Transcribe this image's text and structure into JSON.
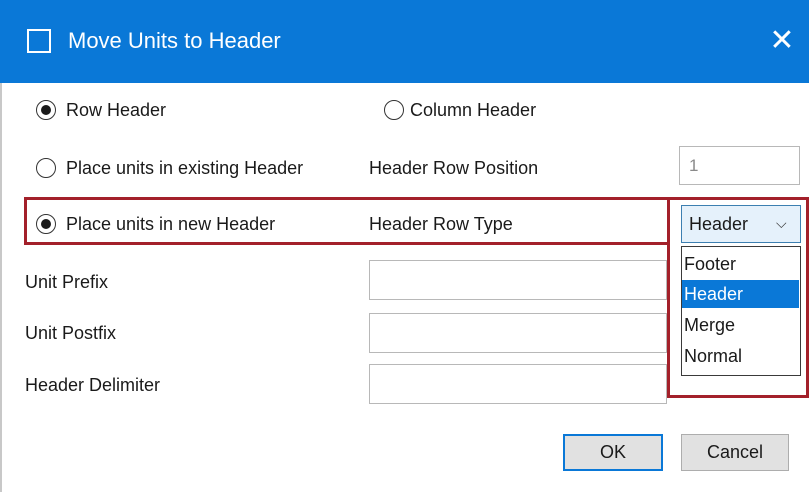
{
  "window": {
    "title": "Move Units to Header",
    "close_glyph": "✕",
    "title_icon": "window-icon",
    "accent_color": "#0a78d7",
    "highlight_color": "#a3202a"
  },
  "orientation": {
    "row_header_label": "Row Header",
    "row_header_checked": true,
    "column_header_label": "Column Header",
    "column_header_checked": false
  },
  "placement": {
    "existing_label": "Place units in existing Header",
    "existing_checked": false,
    "row_position_label": "Header Row Position",
    "row_position_value": "1",
    "new_label": "Place units in new Header",
    "new_checked": true,
    "row_type_label": "Header Row Type",
    "row_type_value": "Header",
    "row_type_chevron": "⌵",
    "row_type_options": [
      "Footer",
      "Header",
      "Merge",
      "Normal"
    ],
    "row_type_selected_index": 1
  },
  "fields": {
    "unit_prefix_label": "Unit Prefix",
    "unit_prefix_value": "",
    "unit_postfix_label": "Unit Postfix",
    "unit_postfix_value": "",
    "header_delimiter_label": "Header Delimiter",
    "header_delimiter_value": ""
  },
  "buttons": {
    "ok_label": "OK",
    "cancel_label": "Cancel"
  }
}
